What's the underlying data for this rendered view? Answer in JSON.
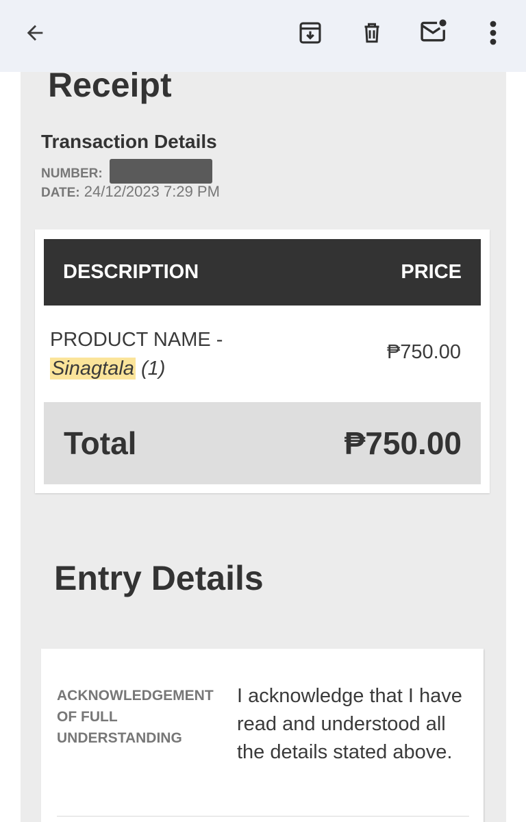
{
  "toolbar": {
    "back_icon": "arrow-left-icon",
    "archive_icon": "archive-icon",
    "delete_icon": "trash-icon",
    "mark_unread_icon": "mail-unread-icon",
    "more_icon": "more-vert-icon"
  },
  "receipt": {
    "title": "Receipt",
    "transaction_heading": "Transaction Details",
    "number_label": "NUMBER:",
    "date_label": "DATE:",
    "date_value": "24/12/2023 7:29 PM"
  },
  "table": {
    "header_description": "DESCRIPTION",
    "header_price": "PRICE",
    "item_prefix": "PRODUCT NAME -",
    "item_name": "Sinagtala",
    "item_qty": "(1)",
    "item_price": "₱750.00",
    "total_label": "Total",
    "total_value": "₱750.00"
  },
  "entry": {
    "heading": "Entry Details",
    "field_label": "ACKNOWLEDGEMENT OF FULL UNDERSTANDING",
    "field_value": "I acknowledge that I have read and understood all the details stated above."
  },
  "colors": {
    "toolbar_bg": "#eef1f7",
    "table_header_bg": "#333333",
    "total_bg": "#dedede",
    "highlight": "#fbe49a"
  }
}
